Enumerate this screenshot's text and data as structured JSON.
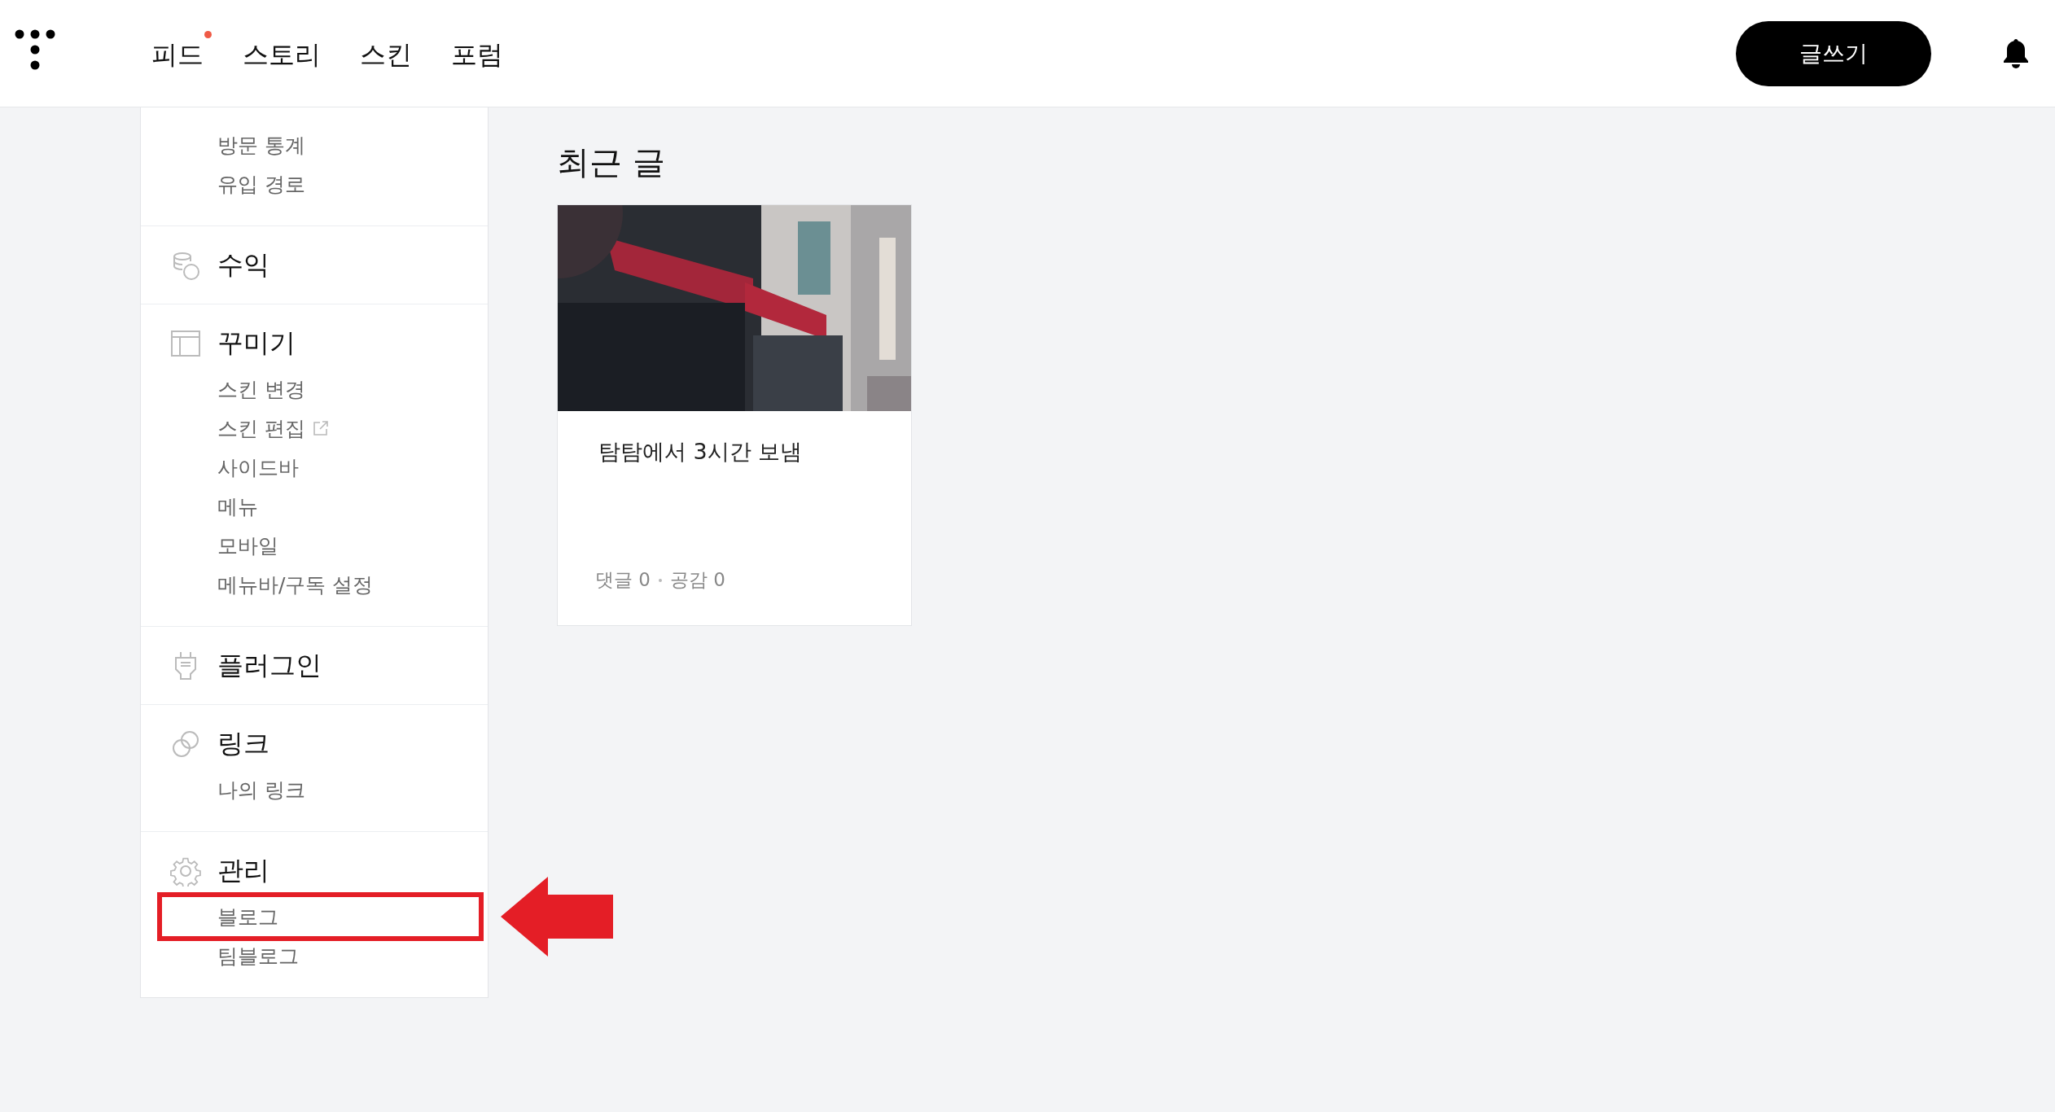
{
  "header": {
    "nav": [
      {
        "label": "피드",
        "badge": true
      },
      {
        "label": "스토리",
        "badge": false
      },
      {
        "label": "스킨",
        "badge": false
      },
      {
        "label": "포럼",
        "badge": false
      }
    ],
    "write_button": "글쓰기"
  },
  "sidebar": {
    "sections": [
      {
        "items": [
          {
            "label": "방문 통계",
            "external": false,
            "highlighted": false
          },
          {
            "label": "유입 경로",
            "external": false,
            "highlighted": false
          }
        ]
      },
      {
        "title": "수익"
      },
      {
        "title": "꾸미기",
        "items": [
          {
            "label": "스킨 변경",
            "external": false,
            "highlighted": false
          },
          {
            "label": "스킨 편집",
            "external": true,
            "highlighted": false
          },
          {
            "label": "사이드바",
            "external": false,
            "highlighted": false
          },
          {
            "label": "메뉴",
            "external": false,
            "highlighted": false
          },
          {
            "label": "모바일",
            "external": false,
            "highlighted": false
          },
          {
            "label": "메뉴바/구독 설정",
            "external": false,
            "highlighted": false
          }
        ]
      },
      {
        "title": "플러그인"
      },
      {
        "title": "링크",
        "items": [
          {
            "label": "나의 링크",
            "external": false,
            "highlighted": false
          }
        ]
      },
      {
        "title": "관리",
        "items": [
          {
            "label": "블로그",
            "external": false,
            "highlighted": true
          },
          {
            "label": "팀블로그",
            "external": false,
            "highlighted": false
          }
        ]
      }
    ]
  },
  "recent_posts": {
    "heading": "최근 글",
    "posts": [
      {
        "title": "탐탐에서 3시간 보냄",
        "comments": "댓글 0",
        "likes": "공감 0"
      }
    ]
  }
}
